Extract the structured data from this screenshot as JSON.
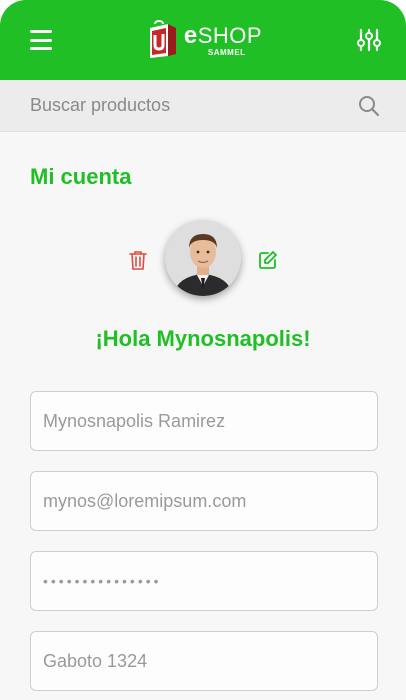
{
  "header": {
    "logo_letter_e": "e",
    "logo_word": "SHOP",
    "logo_sub": "SAMMEL",
    "bar_color": "#1fbf25",
    "menu_icon": "hamburger-icon",
    "filter_icon": "sliders-icon"
  },
  "search": {
    "placeholder": "Buscar productos",
    "icon": "search-icon"
  },
  "account": {
    "title": "Mi cuenta",
    "greeting": "¡Hola Mynosnapolis!",
    "delete_icon": "trash-icon",
    "edit_icon": "edit-icon",
    "accent_color": "#1fbf25",
    "delete_color": "#e04b3f"
  },
  "form": {
    "name_value": "Mynosnapolis Ramirez",
    "email_value": "mynos@loremipsum.com",
    "password_value": "•••••••••••••••",
    "address_value": "Gaboto 1324"
  }
}
